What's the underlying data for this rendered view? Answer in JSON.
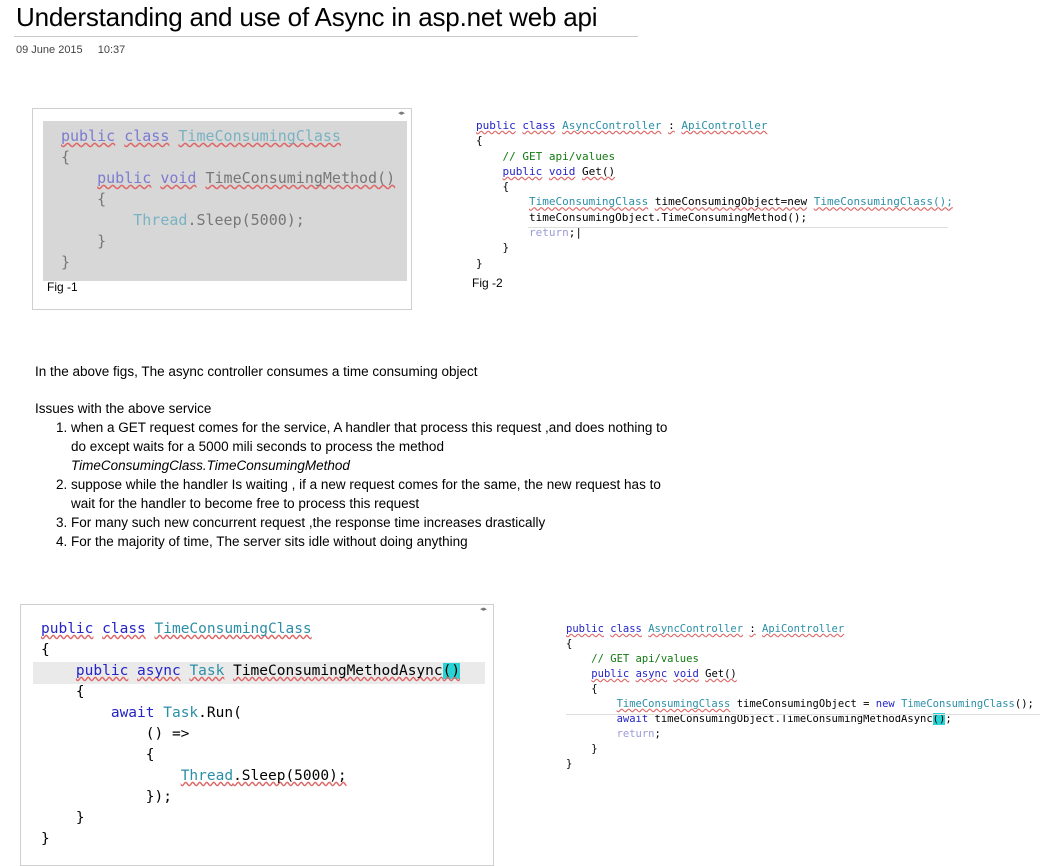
{
  "title": "Understanding and use of Async in asp.net web api",
  "date": "09 June 2015",
  "time": "10:37",
  "fig1": {
    "caption": "Fig -1"
  },
  "fig2": {
    "caption": "Fig -2"
  },
  "prose": {
    "intro": "In the above figs, The async controller consumes a time consuming object",
    "issues_heading": "Issues with the above service",
    "issues": [
      {
        "text": "when a  GET request comes for the service, A handler that process this request ,and does nothing to do  except  waits for a 5000 mili seconds to process the  method",
        "italic": "TimeConsumingClass.TimeConsumingMethod"
      },
      {
        "text": "suppose  while the handler Is  waiting , if a new request comes for the same, the new request has to wait for the handler to become free to process this request",
        "italic": ""
      },
      {
        "text": "For many such  new concurrent request ,the response time increases drastically",
        "italic": ""
      },
      {
        "text": "For the majority of time, The server sits idle without doing anything",
        "italic": ""
      }
    ]
  },
  "colors": {
    "keyword": "#2424c8",
    "type": "#2b8fa8",
    "comment": "#117a11",
    "cursor": "#29d3d3"
  }
}
